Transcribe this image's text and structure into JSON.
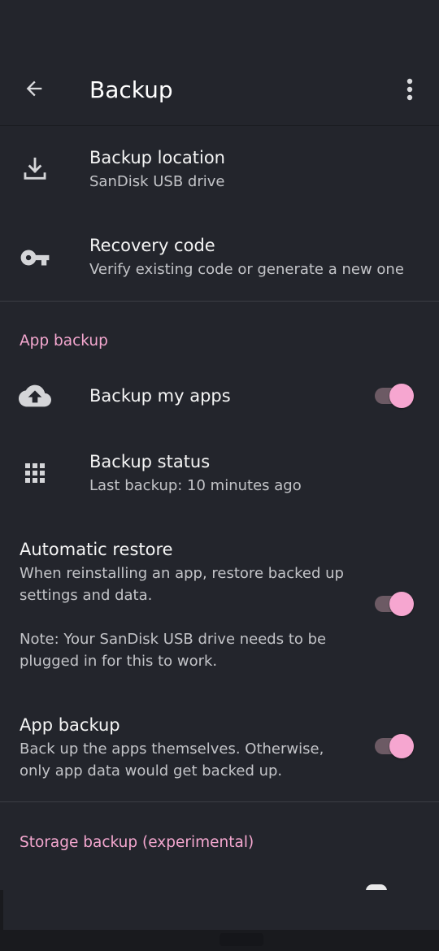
{
  "appbar": {
    "title": "Backup"
  },
  "items": {
    "backup_location": {
      "title": "Backup location",
      "subtitle": "SanDisk USB drive",
      "icon": "download-icon"
    },
    "recovery_code": {
      "title": "Recovery code",
      "subtitle": "Verify existing code or generate a new one",
      "icon": "key-icon"
    }
  },
  "sections": {
    "app_backup_header": "App backup",
    "storage_backup_header": "Storage backup (experimental)"
  },
  "app_backup": {
    "backup_my_apps": {
      "title": "Backup my apps",
      "enabled": true,
      "icon": "cloud-upload-icon"
    },
    "backup_status": {
      "title": "Backup status",
      "subtitle": "Last backup: 10 minutes ago",
      "icon": "apps-grid-icon"
    },
    "automatic_restore": {
      "title": "Automatic restore",
      "line1": "When reinstalling an app, restore backed up",
      "line2": "settings and data.",
      "note1": "Note: Your SanDisk USB drive needs to be",
      "note2": "plugged in for this to work.",
      "enabled": true
    },
    "app_backup_toggle": {
      "title": "App backup",
      "line1": "Back up the apps themselves. Otherwise,",
      "line2": "only app data would get backed up.",
      "enabled": true
    }
  },
  "colors": {
    "background": "#23252c",
    "accent": "#f6a6d0",
    "section_header": "#f4a7cf"
  }
}
